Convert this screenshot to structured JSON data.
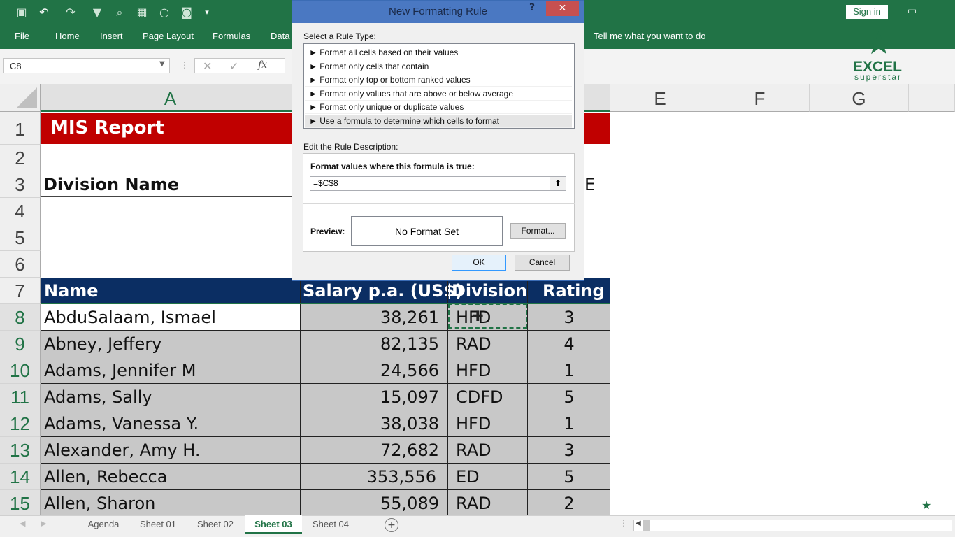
{
  "ribbon": {
    "tabs": [
      "File",
      "Home",
      "Insert",
      "Page Layout",
      "Formulas",
      "Data"
    ],
    "tell_me": "Tell me what you want to do",
    "sign_in": "Sign in"
  },
  "logo": {
    "line1": "EXCEL",
    "line2": "superstar"
  },
  "formula_bar": {
    "name_box": "C8",
    "fx": "fx"
  },
  "columns": {
    "A": "A",
    "E": "E",
    "F": "F",
    "G": "G"
  },
  "rows": [
    "1",
    "2",
    "3",
    "4",
    "5",
    "6",
    "7",
    "8",
    "9",
    "10",
    "11",
    "12",
    "13",
    "14",
    "15"
  ],
  "sheet": {
    "title": "MIS Report",
    "division_label": "Division Name",
    "e_partial": "E",
    "headers": {
      "name": "Name",
      "salary": "Salary p.a. (US$)",
      "division": "Division",
      "rating": "Rating"
    },
    "data": [
      {
        "name": "AbduSalaam, Ismael",
        "salary": "38,261",
        "division": "HFD",
        "rating": "3"
      },
      {
        "name": "Abney, Jeffery",
        "salary": "82,135",
        "division": "RAD",
        "rating": "4"
      },
      {
        "name": "Adams, Jennifer M",
        "salary": "24,566",
        "division": "HFD",
        "rating": "1"
      },
      {
        "name": "Adams, Sally",
        "salary": "15,097",
        "division": "CDFD",
        "rating": "5"
      },
      {
        "name": "Adams, Vanessa Y.",
        "salary": "38,038",
        "division": "HFD",
        "rating": "1"
      },
      {
        "name": "Alexander, Amy H.",
        "salary": "72,682",
        "division": "RAD",
        "rating": "3"
      },
      {
        "name": "Allen, Rebecca",
        "salary": "353,556",
        "division": "ED",
        "rating": "5"
      },
      {
        "name": "Allen, Sharon",
        "salary": "55,089",
        "division": "RAD",
        "rating": "2"
      }
    ]
  },
  "sheet_tabs": [
    "Agenda",
    "Sheet 01",
    "Sheet 02",
    "Sheet 03",
    "Sheet 04"
  ],
  "active_sheet": "Sheet 03",
  "dialog": {
    "title": "New Formatting Rule",
    "help": "?",
    "close": "✕",
    "select_label": "Select a Rule Type:",
    "rule_types": [
      "► Format all cells based on their values",
      "► Format only cells that contain",
      "► Format only top or bottom ranked values",
      "► Format only values that are above or below average",
      "► Format only unique or duplicate values",
      "► Use a formula to determine which cells to format"
    ],
    "selected_rule": 5,
    "edit_label": "Edit the Rule Description:",
    "formula_label": "Format values where this formula is true:",
    "formula_value": "=$C$8",
    "preview_label": "Preview:",
    "preview_text": "No Format Set",
    "format_button": "Format...",
    "ok": "OK",
    "cancel": "Cancel"
  },
  "colors": {
    "excel_green": "#217346",
    "title_red": "#c00000",
    "header_navy": "#0b2e63",
    "row_gray": "#c8c8c8"
  }
}
